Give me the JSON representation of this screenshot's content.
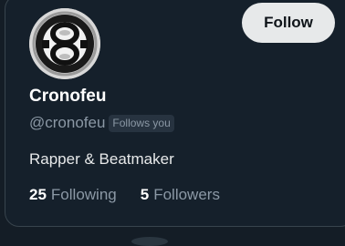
{
  "profile": {
    "display_name": "Cronofeu",
    "handle": "@cronofeu",
    "follows_you_badge": "Follows you",
    "bio": "Rapper & Beatmaker",
    "avatar_icon": "hourglass-logo-icon",
    "follow_button_label": "Follow"
  },
  "stats": {
    "following_count": "25",
    "following_label": "Following",
    "followers_count": "5",
    "followers_label": "Followers"
  },
  "colors": {
    "background": "#15202b",
    "card_border": "#38444d",
    "primary_text": "#ffffff",
    "secondary_text": "#8b98a5",
    "button_bg": "#e7e9ea",
    "badge_bg": "#273340"
  }
}
